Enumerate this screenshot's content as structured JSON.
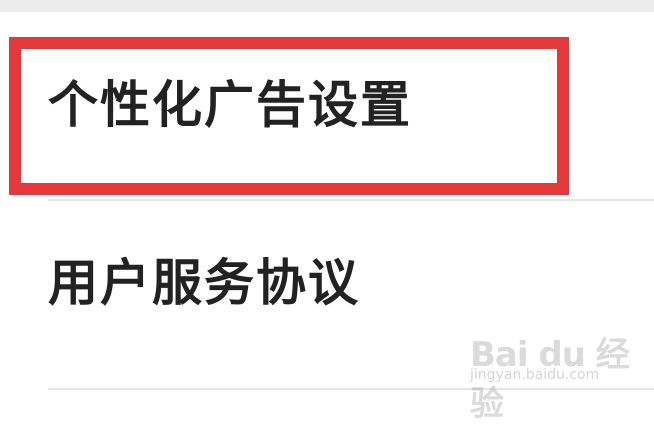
{
  "settings": {
    "items": [
      {
        "label": "个性化广告设置"
      },
      {
        "label": "用户服务协议"
      }
    ]
  },
  "annotation": {
    "highlight_color": "#e6383b"
  },
  "watermark": {
    "brand": "Bai du 经验",
    "url": "jingyan.baidu.com"
  }
}
